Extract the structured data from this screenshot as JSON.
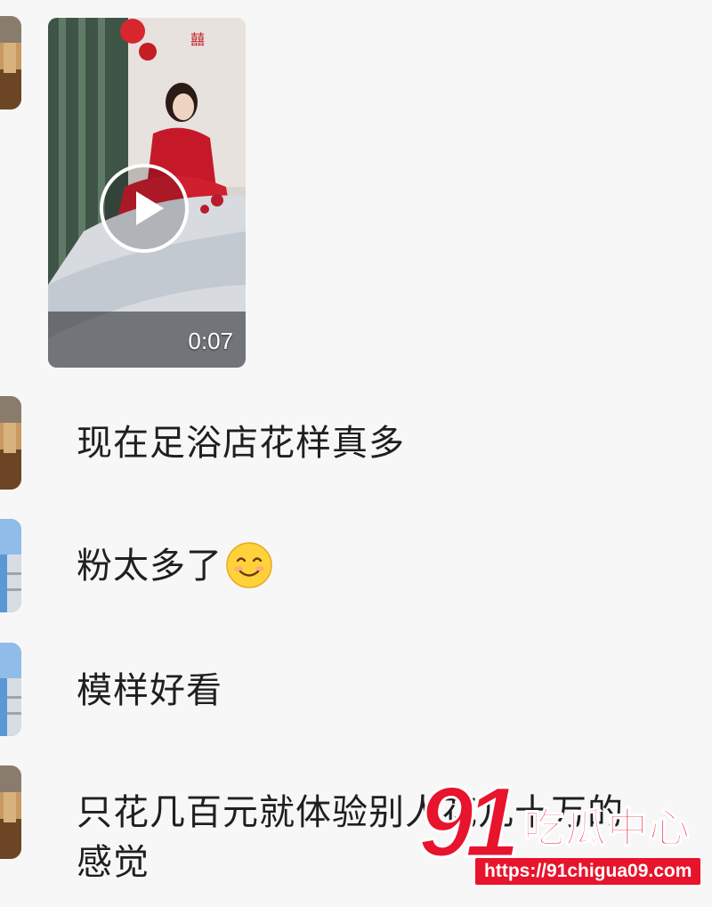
{
  "messages": [
    {
      "type": "video",
      "duration": "0:07"
    },
    {
      "type": "text",
      "text": "现在足浴店花样真多"
    },
    {
      "type": "text",
      "text": "粉太多了",
      "emoji": "smiling-face-emoji"
    },
    {
      "type": "text",
      "text": "模样好看"
    },
    {
      "type": "text",
      "line1": "只花几百元就体验别人花几十万的",
      "line2": "感觉"
    }
  ],
  "watermark": {
    "number": "91",
    "title": "吃瓜中心",
    "url": "https://91chigua09.com"
  },
  "colors": {
    "background": "#f7f7f7",
    "text": "#1f1f1f",
    "watermark_red": "#e8132c"
  }
}
